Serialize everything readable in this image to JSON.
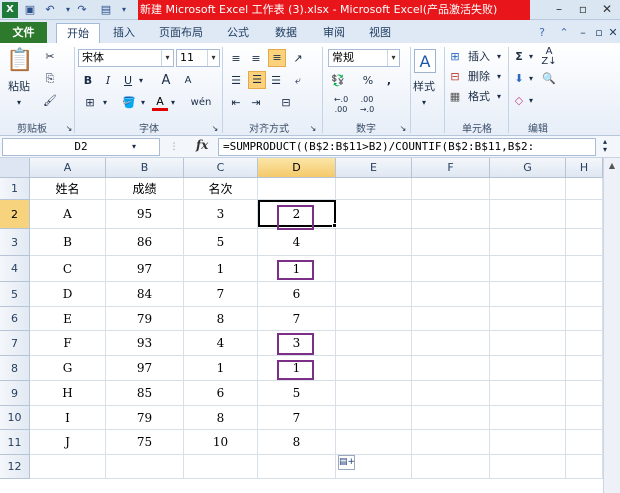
{
  "window": {
    "title": "新建 Microsoft Excel 工作表 (3).xlsx - Microsoft Excel(产品激活失败)",
    "app_icon": "X",
    "qat_icons": [
      "save-icon",
      "undo-icon",
      "redo-icon",
      "print-preview-icon"
    ],
    "controls": [
      "minimize-icon",
      "maximize-icon",
      "close-icon"
    ]
  },
  "tabs": [
    {
      "label": "文件"
    },
    {
      "label": "开始"
    },
    {
      "label": "插入"
    },
    {
      "label": "页面布局"
    },
    {
      "label": "公式"
    },
    {
      "label": "数据"
    },
    {
      "label": "审阅"
    },
    {
      "label": "视图"
    }
  ],
  "ribbon": {
    "clipboard": {
      "label": "剪贴板",
      "paste": "粘贴"
    },
    "font": {
      "label": "字体",
      "name": "宋体",
      "size": "11",
      "bold": "B",
      "italic": "I",
      "underline": "U",
      "grow": "A",
      "shrink": "A",
      "color_letter": "A",
      "phonetic": "wén"
    },
    "alignment": {
      "label": "对齐方式"
    },
    "number": {
      "label": "数字",
      "format": "常规",
      "percent": "%",
      "comma": ","
    },
    "styles": {
      "label": "样式",
      "letter": "A"
    },
    "cells": {
      "label": "单元格",
      "insert": "插入",
      "delete": "删除",
      "format": "格式"
    },
    "editing": {
      "label": "编辑",
      "sigma": "Σ"
    }
  },
  "formula_bar": {
    "name_box": "D2",
    "fx": "fx",
    "formula": "=SUMPRODUCT((B$2:B$11>B2)/COUNTIF(B$2:B$11,B$2:"
  },
  "columns": [
    "A",
    "B",
    "C",
    "D",
    "E",
    "F",
    "G",
    "H"
  ],
  "rows": [
    "1",
    "2",
    "3",
    "4",
    "5",
    "6",
    "7",
    "8",
    "9",
    "10",
    "11",
    "12"
  ],
  "headers": [
    "姓名",
    "成绩",
    "名次"
  ],
  "table": [
    {
      "name": "A",
      "score": "95",
      "rank": "3",
      "d": "2"
    },
    {
      "name": "B",
      "score": "86",
      "rank": "5",
      "d": "4"
    },
    {
      "name": "C",
      "score": "97",
      "rank": "1",
      "d": "1"
    },
    {
      "name": "D",
      "score": "84",
      "rank": "7",
      "d": "6"
    },
    {
      "name": "E",
      "score": "79",
      "rank": "8",
      "d": "7"
    },
    {
      "name": "F",
      "score": "93",
      "rank": "4",
      "d": "3"
    },
    {
      "name": "G",
      "score": "97",
      "rank": "1",
      "d": "1"
    },
    {
      "name": "H",
      "score": "85",
      "rank": "6",
      "d": "5"
    },
    {
      "name": "I",
      "score": "79",
      "rank": "8",
      "d": "7"
    },
    {
      "name": "J",
      "score": "75",
      "rank": "10",
      "d": "8"
    }
  ],
  "colors": {
    "title_bar": "#e8161b",
    "file_tab": "#2d7a2d",
    "highlight_box": "#7b2f86",
    "selection": "#f7d37d"
  }
}
